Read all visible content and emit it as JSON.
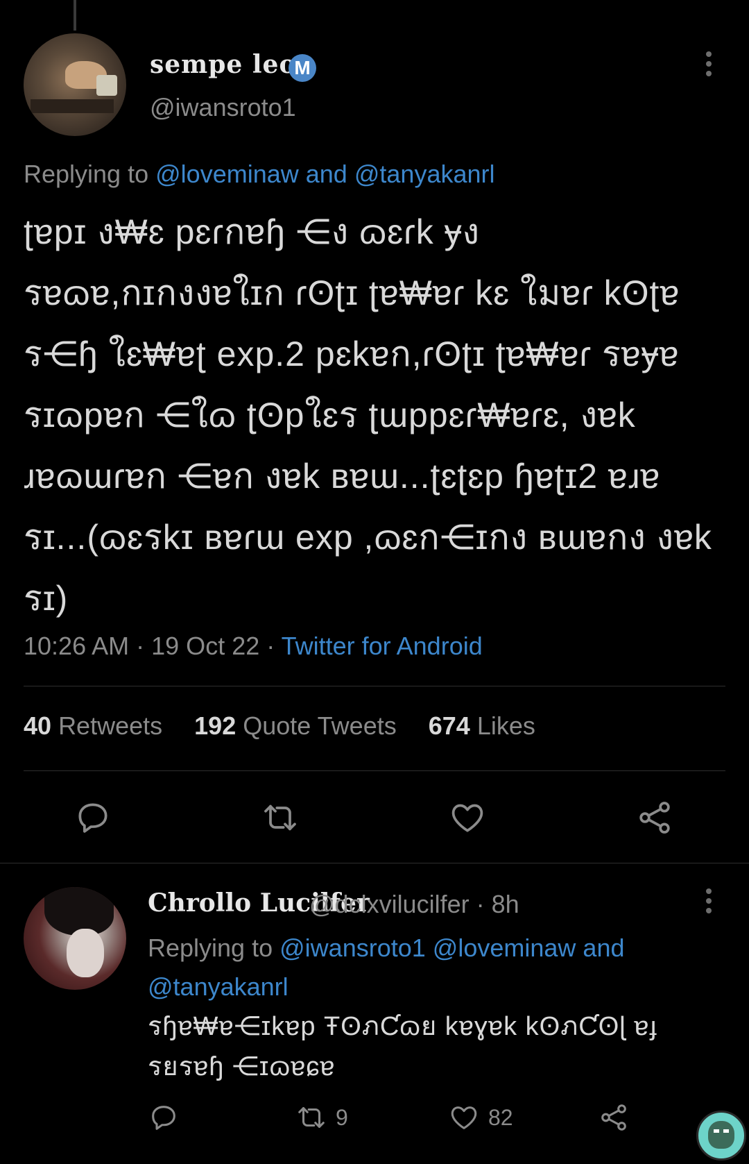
{
  "tweet": {
    "display_name": "sempe leo",
    "verified_badge": "M",
    "handle": "@iwansroto1",
    "replying_prefix": "Replying to",
    "replying_to_1": "@loveminaw",
    "replying_and": "and",
    "replying_to_2": "@tanyakanrl",
    "body": "ʈɐpɪ ง₩ɛ pɛɾกɐɧ ⋲ง ɷɛɾk ɏง รɐɷɐ,กɪกงงɐใɪก ɾʘʈɪ ʈɐ₩ɐɾ kɛ ใมɐɾ kʘʈɐ ร⋲ɧ ใɛ₩ɐʈ exp.2 pɛkɐก,ɾʘʈɪ ʈɐ₩ɐɾ รɐɏɐ รɪɷpɐก ⋲ใɷ ʈʘpใɛร ʈɯppɛɾ₩ɐɾɛ, งɐk ɹɐɷɯɾɐก ⋲ɐก งɐk ʙɐɯ...ʈɛʈɛp ɧɐʈɪ2 ɐɹɐ รɪ...(ɷɛรkɪ ʙɐɾɯ exp ,ɷɛก⋲ɪกง ʙɯɐกง งɐk รɪ)",
    "time": "10:26 AM",
    "date": "19 Oct 22",
    "sep": "·",
    "source": "Twitter for Android",
    "retweets_count": "40",
    "retweets_label": "Retweets",
    "quotes_count": "192",
    "quotes_label": "Quote Tweets",
    "likes_count": "674",
    "likes_label": "Likes"
  },
  "actions": {
    "reply_icon": "reply-icon",
    "retweet_icon": "retweet-icon",
    "like_icon": "heart-icon",
    "share_icon": "share-icon"
  },
  "reply": {
    "display_name": "Chrollo Lucilfer",
    "handle": "@dclxvilucilfer",
    "sep": "·",
    "age": "8h",
    "replying_prefix": "Replying to",
    "replying_to_1": "@iwansroto1",
    "replying_to_2": "@loveminaw",
    "replying_and": "and",
    "replying_to_3": "@tanyakanrl",
    "body": "รɧɐ₩ɐ⋲ɪkɐp ŦʘภƇɷย kɐɣɐk kʘภƇʘɭ ɐɟ รยรɐɧ ⋲ɪɷɐɕɐ",
    "retweet_count": "9",
    "like_count": "82"
  },
  "colors": {
    "background": "#000000",
    "text": "#d9d9d9",
    "muted": "#8b8b8b",
    "link": "#3d87cc",
    "divider": "#2f2f2f"
  }
}
